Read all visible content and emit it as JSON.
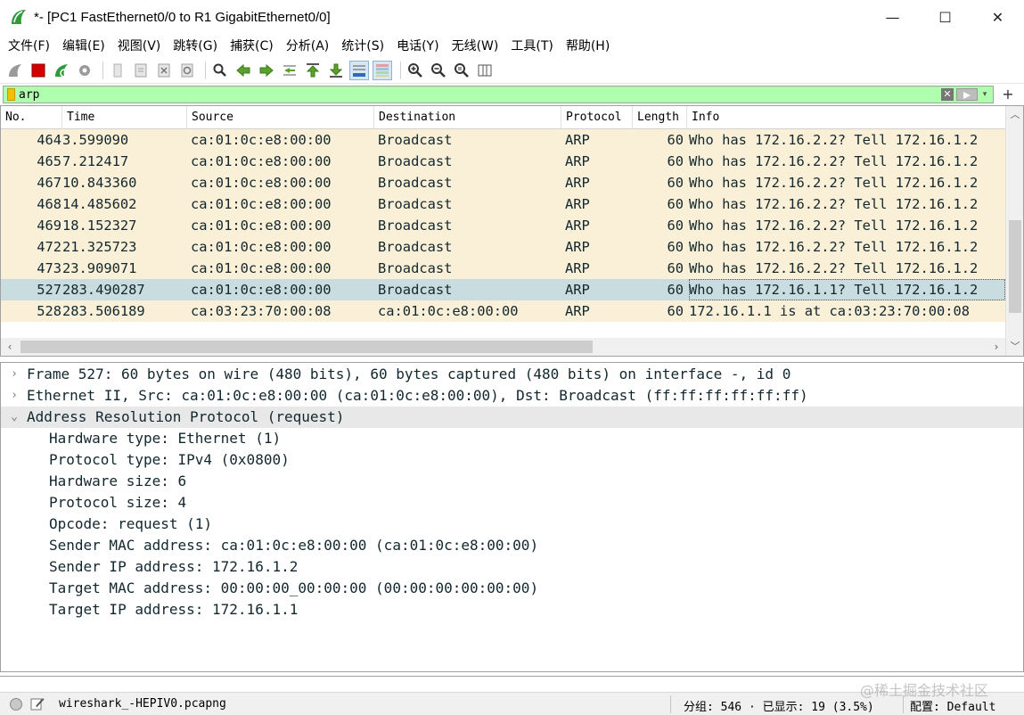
{
  "window": {
    "title": "*- [PC1 FastEthernet0/0 to R1 GigabitEthernet0/0]",
    "minimize_glyph": "—",
    "maximize_glyph": "☐",
    "close_glyph": "✕"
  },
  "menu": [
    "文件(F)",
    "编辑(E)",
    "视图(V)",
    "跳转(G)",
    "捕获(C)",
    "分析(A)",
    "统计(S)",
    "电话(Y)",
    "无线(W)",
    "工具(T)",
    "帮助(H)"
  ],
  "filter": {
    "value": "arp",
    "add_glyph": "+"
  },
  "columns": {
    "no": "No.",
    "time": "Time",
    "source": "Source",
    "destination": "Destination",
    "protocol": "Protocol",
    "length": "Length",
    "info": "Info"
  },
  "packets": [
    {
      "no": "464",
      "time": "3.599090",
      "source": "ca:01:0c:e8:00:00",
      "destination": "Broadcast",
      "protocol": "ARP",
      "length": "60",
      "info": "Who has 172.16.2.2? Tell 172.16.1.2"
    },
    {
      "no": "465",
      "time": "7.212417",
      "source": "ca:01:0c:e8:00:00",
      "destination": "Broadcast",
      "protocol": "ARP",
      "length": "60",
      "info": "Who has 172.16.2.2? Tell 172.16.1.2"
    },
    {
      "no": "467",
      "time": "10.843360",
      "source": "ca:01:0c:e8:00:00",
      "destination": "Broadcast",
      "protocol": "ARP",
      "length": "60",
      "info": "Who has 172.16.2.2? Tell 172.16.1.2"
    },
    {
      "no": "468",
      "time": "14.485602",
      "source": "ca:01:0c:e8:00:00",
      "destination": "Broadcast",
      "protocol": "ARP",
      "length": "60",
      "info": "Who has 172.16.2.2? Tell 172.16.1.2"
    },
    {
      "no": "469",
      "time": "18.152327",
      "source": "ca:01:0c:e8:00:00",
      "destination": "Broadcast",
      "protocol": "ARP",
      "length": "60",
      "info": "Who has 172.16.2.2? Tell 172.16.1.2"
    },
    {
      "no": "472",
      "time": "21.325723",
      "source": "ca:01:0c:e8:00:00",
      "destination": "Broadcast",
      "protocol": "ARP",
      "length": "60",
      "info": "Who has 172.16.2.2? Tell 172.16.1.2"
    },
    {
      "no": "473",
      "time": "23.909071",
      "source": "ca:01:0c:e8:00:00",
      "destination": "Broadcast",
      "protocol": "ARP",
      "length": "60",
      "info": "Who has 172.16.2.2? Tell 172.16.1.2"
    },
    {
      "no": "527",
      "time": "283.490287",
      "source": "ca:01:0c:e8:00:00",
      "destination": "Broadcast",
      "protocol": "ARP",
      "length": "60",
      "info": "Who has 172.16.1.1? Tell 172.16.1.2",
      "selected": true
    },
    {
      "no": "528",
      "time": "283.506189",
      "source": "ca:03:23:70:00:08",
      "destination": "ca:01:0c:e8:00:00",
      "protocol": "ARP",
      "length": "60",
      "info": "172.16.1.1 is at ca:03:23:70:00:08"
    }
  ],
  "details": [
    {
      "text": "Frame 527: 60 bytes on wire (480 bits), 60 bytes captured (480 bits) on interface -, id 0",
      "expander": "›",
      "level": 0
    },
    {
      "text": "Ethernet II, Src: ca:01:0c:e8:00:00 (ca:01:0c:e8:00:00), Dst: Broadcast (ff:ff:ff:ff:ff:ff)",
      "expander": "›",
      "level": 0
    },
    {
      "text": "Address Resolution Protocol (request)",
      "expander": "⌄",
      "level": 0,
      "highlight": true
    },
    {
      "text": "Hardware type: Ethernet (1)",
      "level": 1
    },
    {
      "text": "Protocol type: IPv4 (0x0800)",
      "level": 1
    },
    {
      "text": "Hardware size: 6",
      "level": 1
    },
    {
      "text": "Protocol size: 4",
      "level": 1
    },
    {
      "text": "Opcode: request (1)",
      "level": 1
    },
    {
      "text": "Sender MAC address: ca:01:0c:e8:00:00 (ca:01:0c:e8:00:00)",
      "level": 1
    },
    {
      "text": "Sender IP address: 172.16.1.2",
      "level": 1
    },
    {
      "text": "Target MAC address: 00:00:00_00:00:00 (00:00:00:00:00:00)",
      "level": 1
    },
    {
      "text": "Target IP address: 172.16.1.1",
      "level": 1
    }
  ],
  "status": {
    "file": "wireshark_-HEPIV0.pcapng",
    "stats": "分组: 546 · 已显示: 19 (3.5%)",
    "profile": "配置: Default",
    "watermark": "@稀土掘金技术社区"
  },
  "colors": {
    "filter_valid_bg": "#afffaf",
    "arp_row_bg": "#faf0d7",
    "selected_row_bg": "#c9dcdf",
    "row_text": "#12272e"
  }
}
